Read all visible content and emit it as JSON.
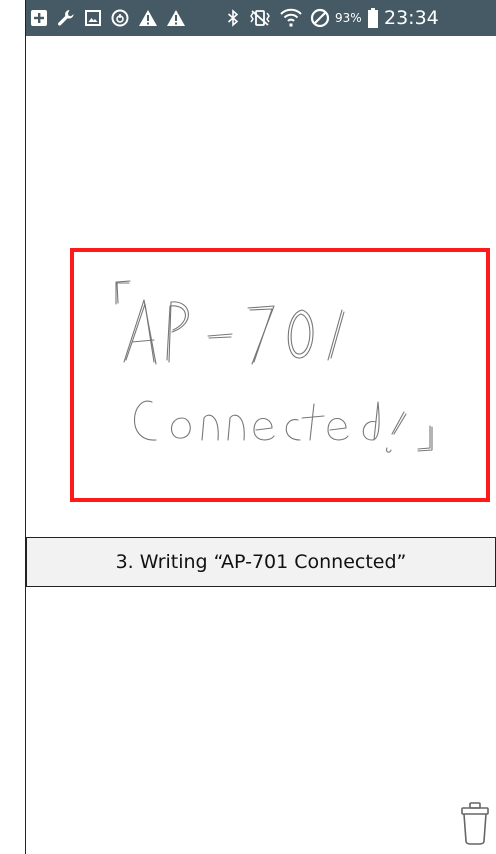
{
  "status_bar": {
    "left_icons": [
      "add-icon",
      "wrench-icon",
      "image-icon",
      "sync-icon",
      "warning-icon",
      "warning-icon"
    ],
    "right_icons": [
      "bluetooth-icon",
      "vibrate-icon",
      "wifi-icon",
      "blocked-icon",
      "battery-icon"
    ],
    "battery_percent": "93%",
    "battery_level": 0.93,
    "time": "23:34",
    "background_color": "#455a64"
  },
  "canvas": {
    "handwriting_lines": [
      "「AP-701",
      "Connected !」"
    ],
    "frame_color": "#ff1a1a"
  },
  "caption": {
    "text": "3. Writing “AP-701 Connected”"
  },
  "actions": {
    "trash_icon": "trash-icon"
  }
}
